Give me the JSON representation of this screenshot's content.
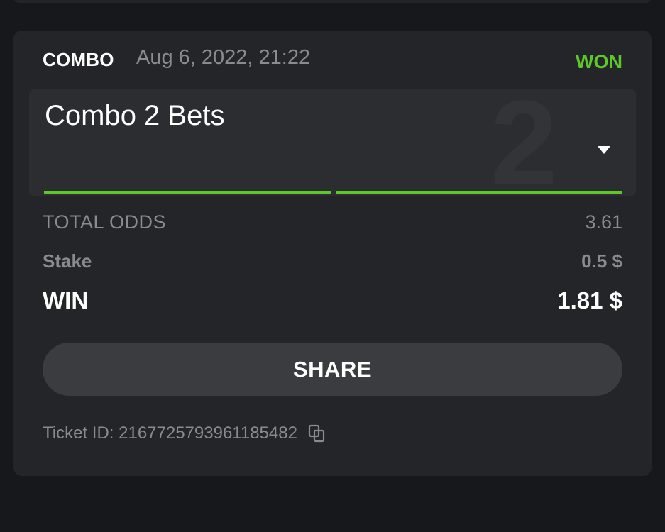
{
  "bet": {
    "type": "COMBO",
    "date": "Aug 6, 2022, 21:22",
    "status": "WON",
    "status_color": "#5ec72c",
    "combo": {
      "title": "Combo 2 Bets",
      "count": "2",
      "legs_won": 2,
      "legs_total": 2
    },
    "total_odds_label": "TOTAL ODDS",
    "total_odds_value": "3.61",
    "stake_label": "Stake",
    "stake_value": "0.5 $",
    "win_label": "WIN",
    "win_value": "1.81 $",
    "share_label": "SHARE",
    "ticket_id_text": "Ticket ID: 2167725793961185482",
    "icons": {
      "dropdown": "caret-down-icon",
      "copy": "copy-icon"
    }
  }
}
